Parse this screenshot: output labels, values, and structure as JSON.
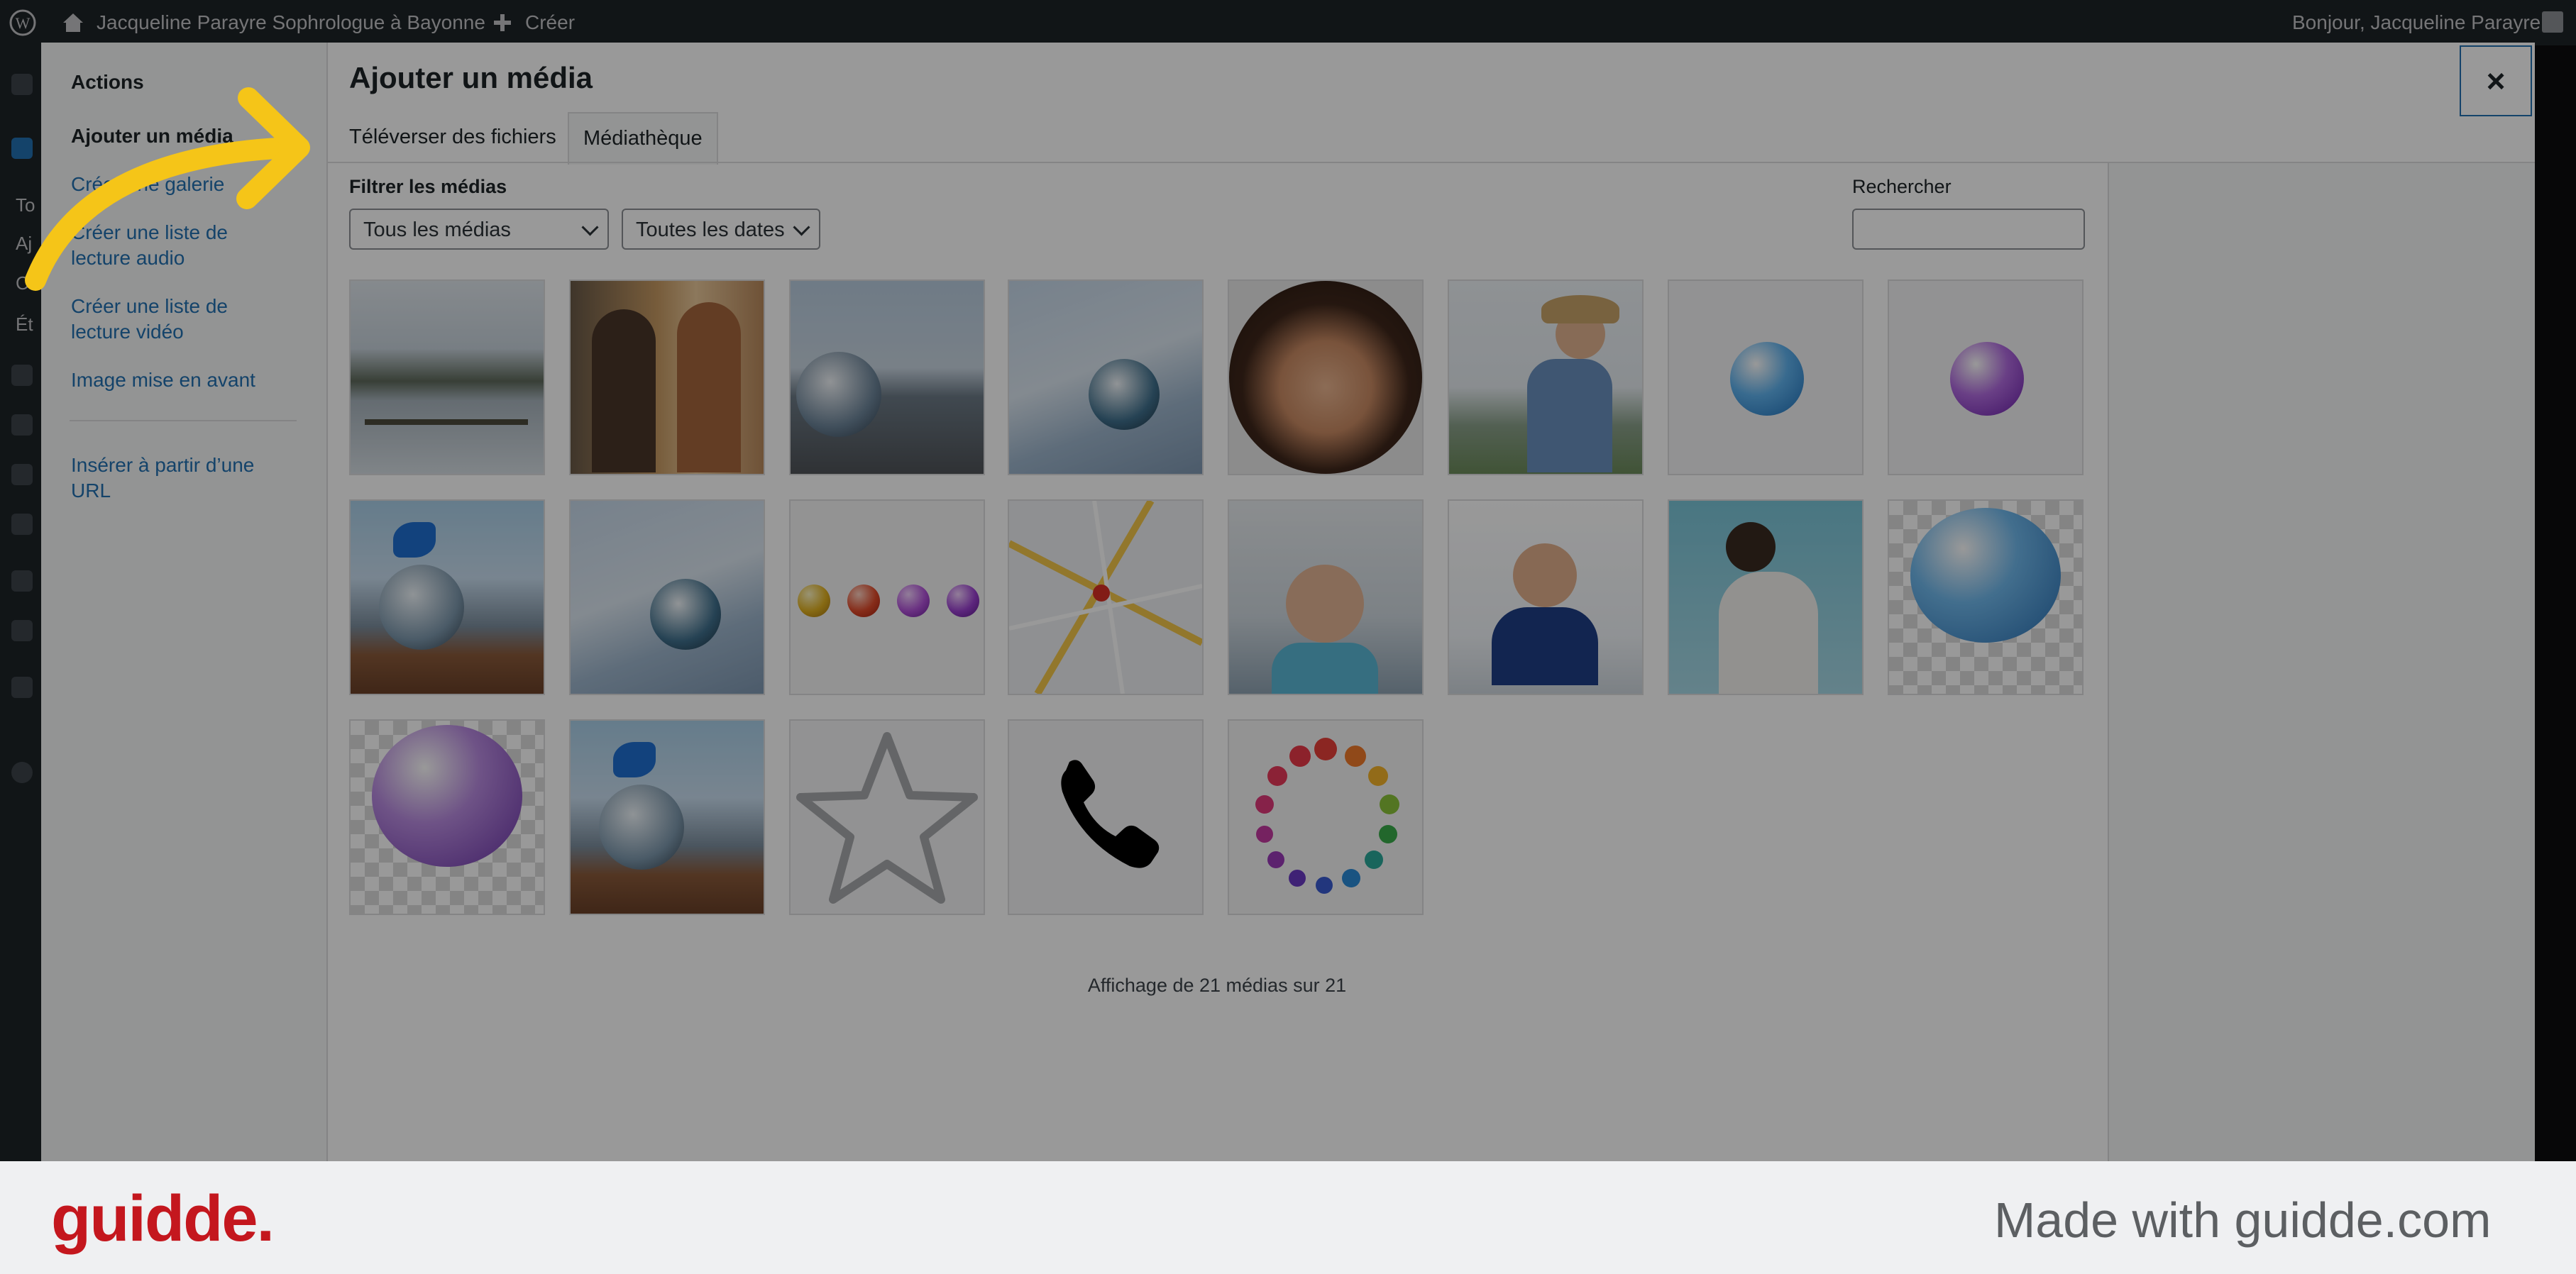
{
  "admin_bar": {
    "site_name": "Jacqueline Parayre Sophrologue à Bayonne",
    "new_label": "Créer",
    "greeting": "Bonjour, Jacqueline Parayre"
  },
  "background_menu_fragments": [
    "To",
    "Aj",
    "Ca",
    "Ét"
  ],
  "sidebar": {
    "heading": "Actions",
    "items": [
      {
        "label": "Ajouter un média",
        "active": true
      },
      {
        "label": "Créer une galerie"
      },
      {
        "label": "Créer une liste de lecture audio"
      },
      {
        "label": "Créer une liste de lecture vidéo"
      },
      {
        "label": "Image mise en avant"
      },
      {
        "label": "Insérer à partir d’une URL"
      }
    ]
  },
  "modal": {
    "title": "Ajouter un média",
    "close_label": "×",
    "tabs": [
      {
        "label": "Téléverser des fichiers"
      },
      {
        "label": "Médiathèque",
        "active": true
      }
    ]
  },
  "filters": {
    "label": "Filtrer les médias",
    "type_select": "Tous les médias",
    "date_select": "Toutes les dates",
    "search_label": "Rechercher",
    "search_value": ""
  },
  "media_items": [
    "lake-rowing-photo",
    "two-women-photo",
    "crystal-ball-beach-photo",
    "crystal-ball-feather-photo",
    "portrait-circle-photo",
    "woman-hat-photo",
    "blue-sphere",
    "purple-sphere",
    "butterfly-crystal-photo",
    "crystal-ball-feather-photo",
    "color-spheres-row",
    "map-image",
    "seniors-photo",
    "man-relaxing-photo",
    "pregnant-woman-photo",
    "blue-sphere-large",
    "purple-sphere-large",
    "butterfly-crystal-photo",
    "star-outline",
    "phone-icon",
    "rainbow-dots-circle"
  ],
  "count_text": "Affichage de 21 médias sur 21",
  "footer": {
    "logo": "guidde.",
    "made_with": "Made with guidde.com"
  },
  "colors": {
    "accent": "#2271b1",
    "arrow": "#f5c518",
    "logo": "#c4171e"
  }
}
